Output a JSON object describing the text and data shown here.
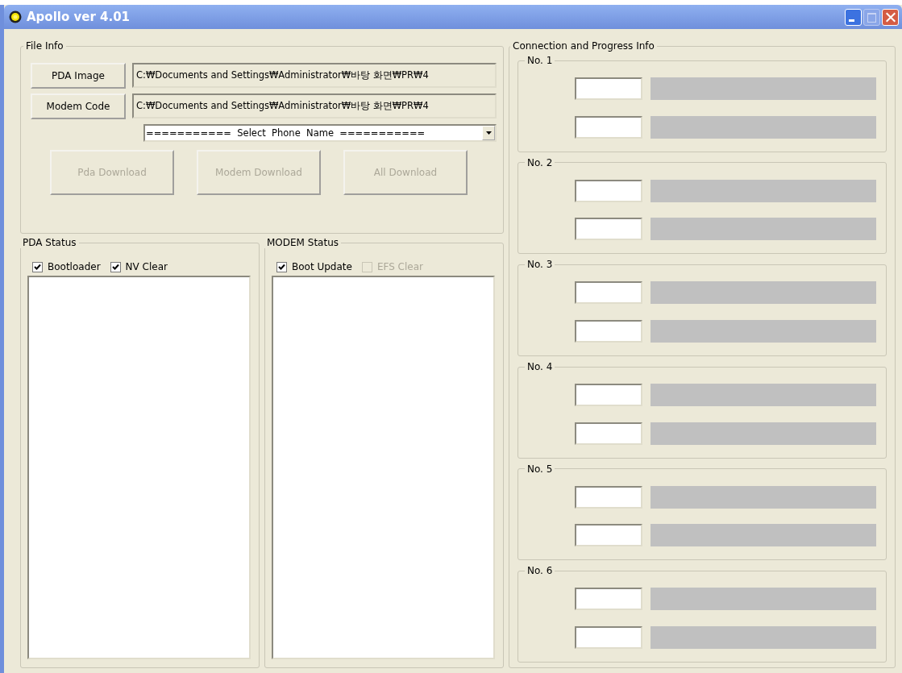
{
  "window": {
    "title": "Apollo ver 4.01",
    "controls": [
      {
        "kind": "minimize",
        "disabled": false
      },
      {
        "kind": "maximize",
        "disabled": true
      },
      {
        "kind": "close",
        "disabled": false
      }
    ]
  },
  "file_info": {
    "title": "File Info",
    "files": [
      {
        "button": "PDA Image",
        "path": "C:₩Documents and Settings₩Administrator₩바탕 화면₩PR₩4"
      },
      {
        "button": "Modem Code",
        "path": "C:₩Documents and Settings₩Administrator₩바탕 화면₩PR₩4"
      }
    ],
    "phone_select": {
      "value": "===========  Select  Phone  Name  ==========="
    },
    "buttons": [
      {
        "label": "Pda Download",
        "disabled": true
      },
      {
        "label": "Modem Download",
        "disabled": true
      },
      {
        "label": "All Download",
        "disabled": true
      }
    ]
  },
  "pda_status": {
    "title": "PDA Status",
    "options": [
      {
        "label": "Bootloader",
        "checked": true,
        "disabled": false
      },
      {
        "label": "NV Clear",
        "checked": true,
        "disabled": false
      }
    ]
  },
  "modem_status": {
    "title": "MODEM Status",
    "options": [
      {
        "label": "Boot Update",
        "checked": true,
        "disabled": false
      },
      {
        "label": "EFS Clear",
        "checked": false,
        "disabled": true
      }
    ]
  },
  "connection": {
    "title": "Connection and Progress Info",
    "ports": [
      {
        "label": "No. 1",
        "bars": [
          {
            "level": 0
          },
          {
            "level": 0
          }
        ]
      },
      {
        "label": "No. 2",
        "bars": [
          {
            "level": 0
          },
          {
            "level": 0
          }
        ]
      },
      {
        "label": "No. 3",
        "bars": [
          {
            "level": 0
          },
          {
            "level": 0
          }
        ]
      },
      {
        "label": "No. 4",
        "bars": [
          {
            "level": 0
          },
          {
            "level": 0
          }
        ]
      },
      {
        "label": "No. 5",
        "bars": [
          {
            "level": 0
          },
          {
            "level": 0
          }
        ]
      },
      {
        "label": "No. 6",
        "bars": [
          {
            "level": 0
          },
          {
            "level": 0
          }
        ]
      }
    ]
  }
}
